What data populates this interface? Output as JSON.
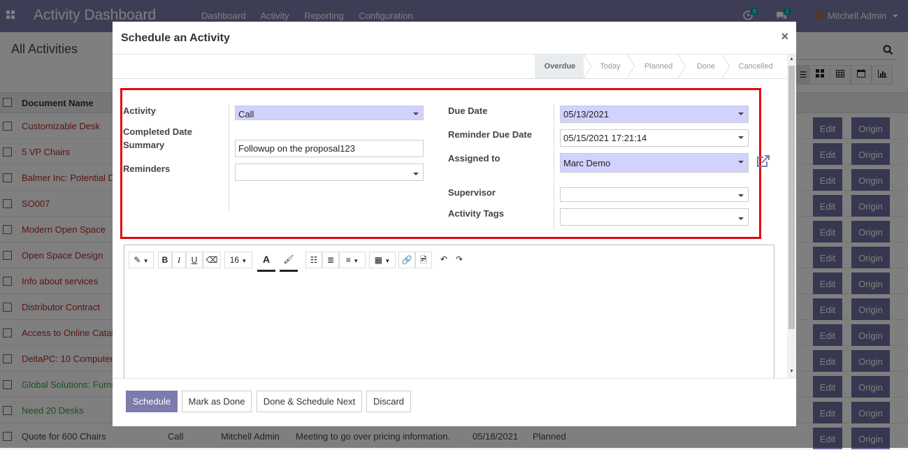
{
  "navbar": {
    "title": "Activity Dashboard",
    "menu": [
      "Dashboard",
      "Activity",
      "Reporting",
      "Configuration"
    ],
    "activity_count": "8",
    "message_count": "1",
    "user_name": "Mitchell Admin"
  },
  "control_panel": {
    "title": "All Activities"
  },
  "list": {
    "header_document_name": "Document Name",
    "rows": [
      {
        "name": "Customizable Desk",
        "color": "#b5282b"
      },
      {
        "name": "5 VP Chairs",
        "color": "#b5282b"
      },
      {
        "name": "Balmer Inc: Potential D",
        "color": "#b5282b"
      },
      {
        "name": "SO007",
        "color": "#b5282b"
      },
      {
        "name": "Modern Open Space",
        "color": "#b5282b"
      },
      {
        "name": "Open Space Design",
        "color": "#b5282b"
      },
      {
        "name": "Info about services",
        "color": "#b5282b"
      },
      {
        "name": "Distributor Contract",
        "color": "#b5282b"
      },
      {
        "name": "Access to Online Catal",
        "color": "#b5282b"
      },
      {
        "name": "DeltaPC: 10 Computer",
        "color": "#b5282b"
      },
      {
        "name": "Global Solutions: Furni",
        "color": "#28a745"
      },
      {
        "name": "Need 20 Desks",
        "color": "#28a745"
      },
      {
        "name": "Quote for 600 Chairs",
        "color": "#444444"
      }
    ],
    "last_row": {
      "type": "Call",
      "assigned": "Mitchell Admin",
      "summary": "Meeting to go over pricing information.",
      "date": "05/18/2021",
      "state": "Planned"
    },
    "edit_label": "Edit",
    "origin_label": "Origin"
  },
  "modal": {
    "title": "Schedule an Activity",
    "close": "×",
    "stages": [
      "Overdue",
      "Today",
      "Planned",
      "Done",
      "Cancelled"
    ],
    "labels": {
      "activity": "Activity",
      "completed_date": "Completed Date",
      "summary": "Summary",
      "reminders": "Reminders",
      "due_date": "Due Date",
      "reminder_due_date": "Reminder Due Date",
      "assigned_to": "Assigned to",
      "supervisor": "Supervisor",
      "activity_tags": "Activity Tags"
    },
    "values": {
      "activity": "Call",
      "summary": "Followup on the proposal123",
      "reminders": "",
      "due_date": "05/13/2021",
      "reminder_due_date": "05/15/2021 17:21:14",
      "assigned_to": "Marc Demo",
      "supervisor": "",
      "activity_tags": ""
    },
    "editor": {
      "font_size": "16"
    },
    "buttons": {
      "schedule": "Schedule",
      "mark_done": "Mark as Done",
      "done_next": "Done & Schedule Next",
      "discard": "Discard"
    }
  },
  "colors": {
    "brand": "#7c7bad",
    "required_field": "#d2d2ff",
    "highlight_box": "#e30613",
    "overdue_text": "#b5282b",
    "today_text": "#28a745"
  }
}
